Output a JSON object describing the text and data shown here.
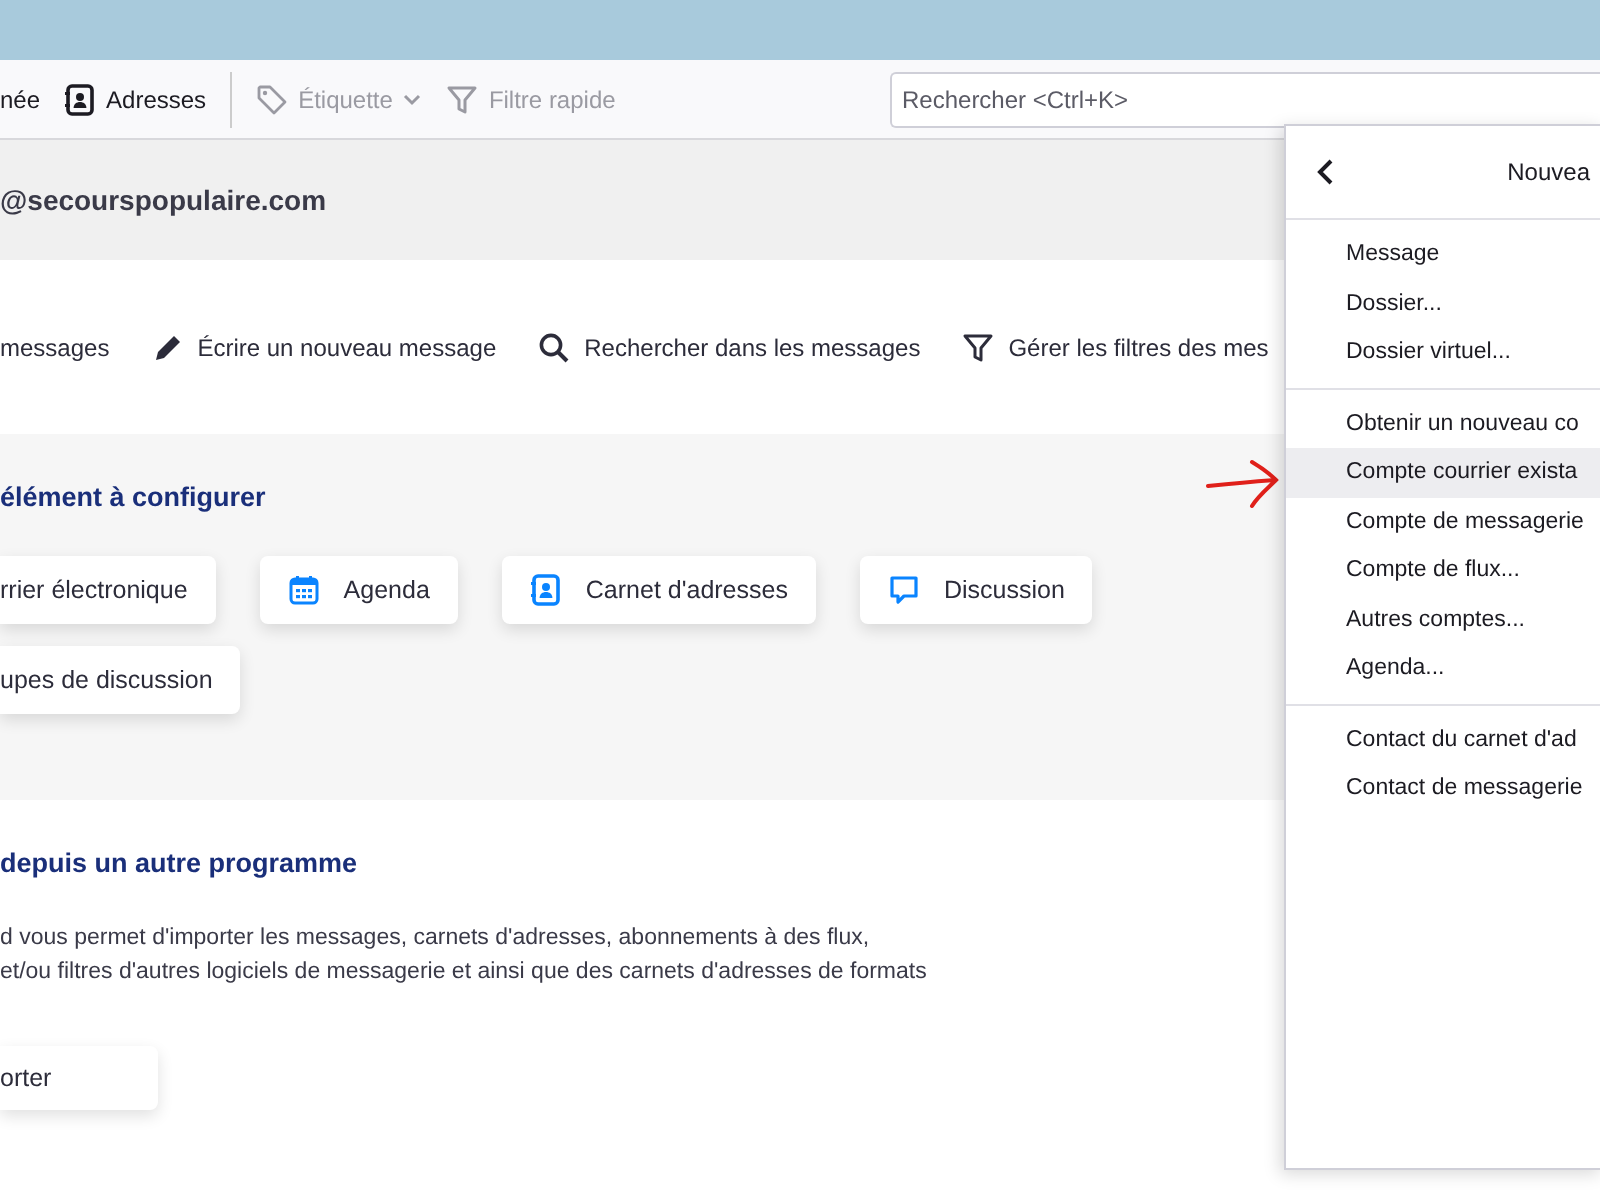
{
  "toolbar": {
    "items": [
      {
        "label": "née",
        "kind": "none",
        "disabled": false
      },
      {
        "label": "Adresses",
        "kind": "address-book",
        "disabled": false
      },
      {
        "label": "Étiquette",
        "kind": "tag",
        "disabled": true,
        "dropdown": true
      },
      {
        "label": "Filtre rapide",
        "kind": "funnel",
        "disabled": true
      }
    ],
    "search": {
      "placeholder": "Rechercher <Ctrl+K>"
    }
  },
  "account": {
    "email": "@secourspopulaire.com"
  },
  "actions": [
    {
      "label": "messages",
      "kind": "none"
    },
    {
      "label": "Écrire un nouveau message",
      "kind": "pencil"
    },
    {
      "label": "Rechercher dans les messages",
      "kind": "search"
    },
    {
      "label": "Gérer les filtres des mes",
      "kind": "funnel"
    }
  ],
  "configure": {
    "heading": "élément à configurer",
    "cards": [
      {
        "label": "rrier électronique",
        "kind": "none"
      },
      {
        "label": "Agenda",
        "kind": "calendar"
      },
      {
        "label": "Carnet d'adresses",
        "kind": "address-book"
      },
      {
        "label": "Discussion",
        "kind": "chat"
      },
      {
        "label": "upes de discussion",
        "kind": "none"
      }
    ]
  },
  "import": {
    "heading": "depuis un autre programme",
    "lines": [
      "d vous permet d'importer les messages, carnets d'adresses, abonnements à des flux,",
      "et/ou filtres d'autres logiciels de messagerie et ainsi que des carnets d'adresses de formats"
    ],
    "button": "orter"
  },
  "menu": {
    "title": "Nouvea",
    "sections": [
      [
        {
          "label": "Message",
          "selected": false
        },
        {
          "label": "Dossier...",
          "selected": false
        },
        {
          "label": "Dossier virtuel...",
          "selected": false
        }
      ],
      [
        {
          "label": "Obtenir un nouveau co",
          "selected": false
        },
        {
          "label": "Compte courrier exista",
          "selected": true
        },
        {
          "label": "Compte de messagerie",
          "selected": false
        },
        {
          "label": "Compte de flux...",
          "selected": false
        },
        {
          "label": "Autres comptes...",
          "selected": false
        },
        {
          "label": "Agenda...",
          "selected": false
        }
      ],
      [
        {
          "label": "Contact du carnet d'ad",
          "selected": false
        },
        {
          "label": "Contact de messagerie",
          "selected": false
        }
      ]
    ]
  }
}
